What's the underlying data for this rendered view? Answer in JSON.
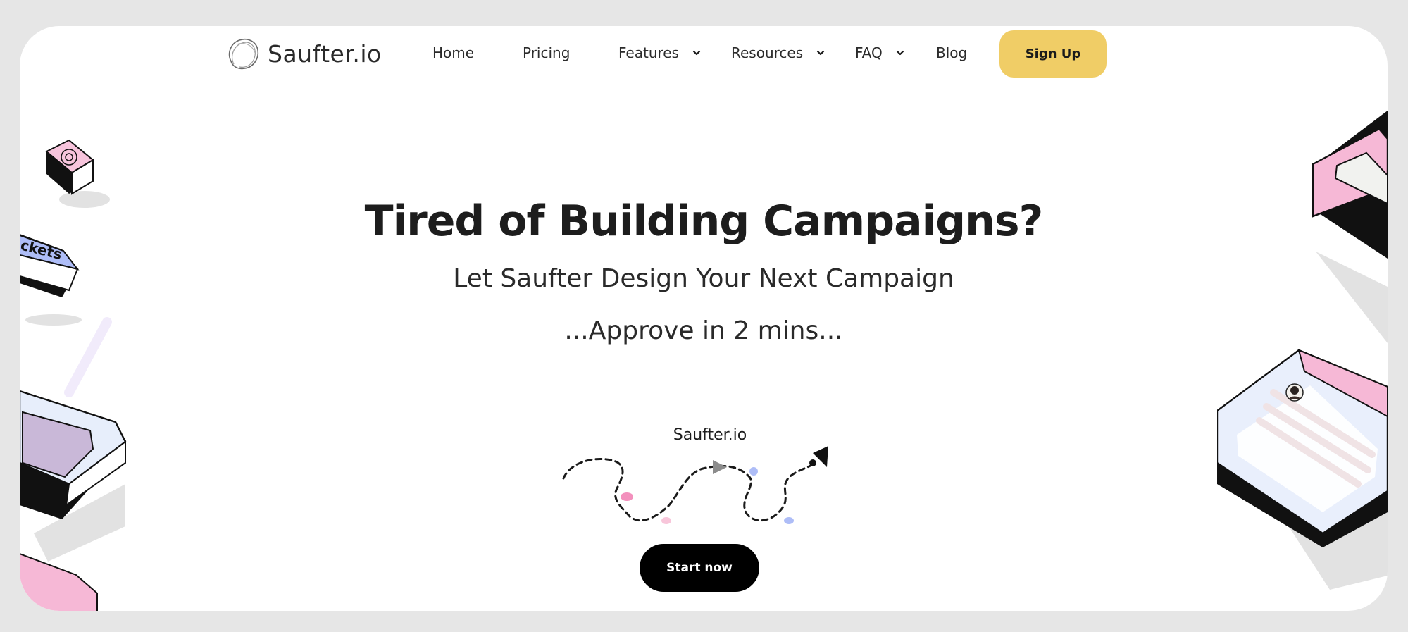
{
  "brand": {
    "name": "Saufter.io"
  },
  "nav": {
    "items": [
      {
        "label": "Home",
        "has_dropdown": false
      },
      {
        "label": "Pricing",
        "has_dropdown": false
      },
      {
        "label": "Features",
        "has_dropdown": true
      },
      {
        "label": "Resources",
        "has_dropdown": true
      },
      {
        "label": "FAQ",
        "has_dropdown": true
      },
      {
        "label": "Blog",
        "has_dropdown": false
      }
    ],
    "cta_label": "Sign Up"
  },
  "hero": {
    "title": "Tired of Building Campaigns?",
    "subtitle": "Let Saufter Design Your Next Campaign",
    "tagline": "...Approve in 2 mins...",
    "video_label": "Saufter.io",
    "cta_label": "Start now"
  },
  "decor": {
    "ticket_label": "ckets"
  },
  "colors": {
    "cta_yellow": "#f0cd66",
    "pink": "#f6b8d6",
    "blue": "#aebdf7",
    "lavender": "#c9b8d8",
    "black": "#000000"
  }
}
